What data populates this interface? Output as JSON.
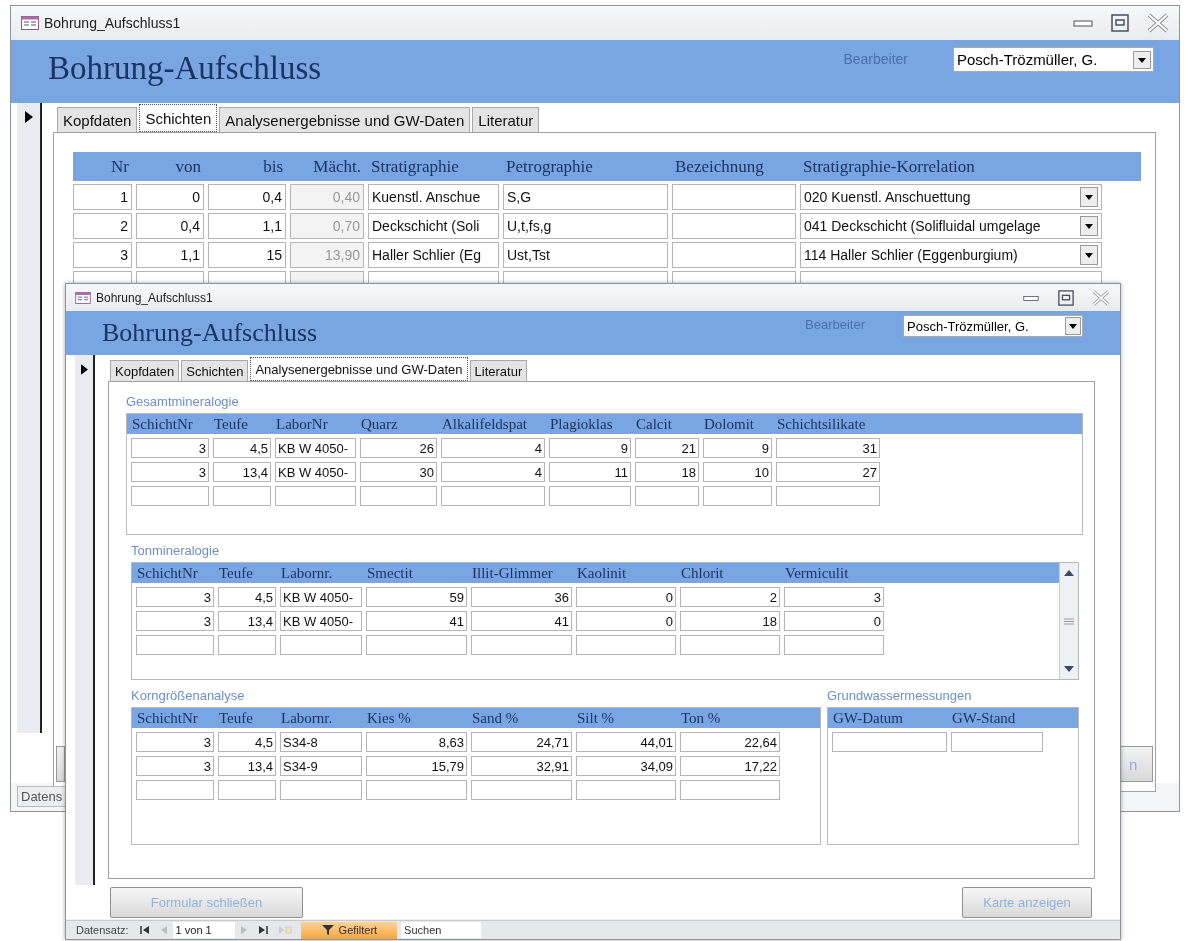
{
  "back_window": {
    "title": "Bohrung_Aufschluss1",
    "heading": "Bohrung-Aufschluss",
    "editor_label": "Bearbeiter",
    "editor": "Posch-Trözmüller, G.",
    "tabs": [
      {
        "label": "Kopfdaten",
        "selected": false
      },
      {
        "label": "Schichten",
        "selected": true
      },
      {
        "label": "Analysenergebnisse und GW-Daten",
        "selected": false
      },
      {
        "label": "Literatur",
        "selected": false
      }
    ],
    "table": {
      "columns": [
        {
          "label": "Nr",
          "kind": "number"
        },
        {
          "label": "von",
          "kind": "number"
        },
        {
          "label": "bis",
          "kind": "number"
        },
        {
          "label": "Mächt.",
          "kind": "computed"
        },
        {
          "label": "Stratigraphie",
          "kind": "text"
        },
        {
          "label": "Petrographie",
          "kind": "text"
        },
        {
          "label": "Bezeichnung",
          "kind": "text"
        },
        {
          "label": "Stratigraphie-Korrelation",
          "kind": "combo"
        }
      ],
      "rows": [
        {
          "nr": "1",
          "von": "0",
          "bis": "0,4",
          "maechtigkeit": "0,40",
          "stratigraphie": "Kuenstl. Anschue",
          "petrographie": "S,G",
          "korrelation": "020 Kuenstl. Anschuettung"
        },
        {
          "nr": "2",
          "von": "0,4",
          "bis": "1,1",
          "maechtigkeit": "0,70",
          "stratigraphie": "Deckschicht (Soli",
          "petrographie": "U,t,fs,g",
          "korrelation": "041 Deckschicht (Solifluidal umgelage"
        },
        {
          "nr": "3",
          "von": "1,1",
          "bis": "15",
          "maechtigkeit": "13,90",
          "stratigraphie": "Haller Schlier (Eg",
          "petrographie": "Ust,Tst",
          "korrelation": "114 Haller Schlier (Eggenburgium)"
        }
      ]
    },
    "button_fragment": "n",
    "status_fragment": "Datens"
  },
  "front_window": {
    "title": "Bohrung_Aufschluss1",
    "heading": "Bohrung-Aufschluss",
    "editor_label": "Bearbeiter",
    "editor": "Posch-Trözmüller, G.",
    "tabs": [
      {
        "label": "Kopfdaten",
        "selected": false
      },
      {
        "label": "Schichten",
        "selected": false
      },
      {
        "label": "Analysenergebnisse und GW-Daten",
        "selected": true
      },
      {
        "label": "Literatur",
        "selected": false
      }
    ],
    "sections": [
      {
        "title": "Gesamtmineralogie",
        "columns": [
          {
            "label": "SchichtNr",
            "kind": "number"
          },
          {
            "label": "Teufe",
            "kind": "number"
          },
          {
            "label": "LaborNr",
            "kind": "text"
          },
          {
            "label": "Quarz",
            "kind": "number"
          },
          {
            "label": "Alkalifeldspat",
            "kind": "number"
          },
          {
            "label": "Plagioklas",
            "kind": "number"
          },
          {
            "label": "Calcit",
            "kind": "number"
          },
          {
            "label": "Dolomit",
            "kind": "number"
          },
          {
            "label": "Schichtsilikate",
            "kind": "number"
          }
        ],
        "rows": [
          [
            "3",
            "4,5",
            "KB W 4050-",
            "26",
            "4",
            "9",
            "21",
            "9",
            "31"
          ],
          [
            "3",
            "13,4",
            "KB W 4050-",
            "30",
            "4",
            "11",
            "18",
            "10",
            "27"
          ]
        ]
      },
      {
        "title": "Tonmineralogie",
        "columns": [
          {
            "label": "SchichtNr",
            "kind": "number"
          },
          {
            "label": "Teufe",
            "kind": "number"
          },
          {
            "label": "Labornr.",
            "kind": "text"
          },
          {
            "label": "Smectit",
            "kind": "number"
          },
          {
            "label": "Illit-Glimmer",
            "kind": "number"
          },
          {
            "label": "Kaolinit",
            "kind": "number"
          },
          {
            "label": "Chlorit",
            "kind": "number"
          },
          {
            "label": "Vermiculit",
            "kind": "number"
          }
        ],
        "rows": [
          [
            "3",
            "4,5",
            "KB W 4050-",
            "59",
            "36",
            "0",
            "2",
            "3"
          ],
          [
            "3",
            "13,4",
            "KB W 4050-",
            "41",
            "41",
            "0",
            "18",
            "0"
          ]
        ]
      },
      {
        "title": "Korngrößenanalyse",
        "columns": [
          {
            "label": "SchichtNr",
            "kind": "number"
          },
          {
            "label": "Teufe",
            "kind": "number"
          },
          {
            "label": "Labornr.",
            "kind": "text"
          },
          {
            "label": "Kies %",
            "kind": "number"
          },
          {
            "label": "Sand %",
            "kind": "number"
          },
          {
            "label": "Silt %",
            "kind": "number"
          },
          {
            "label": "Ton %",
            "kind": "number"
          }
        ],
        "rows": [
          [
            "3",
            "4,5",
            "S34-8",
            "8,63",
            "24,71",
            "44,01",
            "22,64"
          ],
          [
            "3",
            "13,4",
            "S34-9",
            "15,79",
            "32,91",
            "34,09",
            "17,22"
          ]
        ]
      },
      {
        "title": "Grundwassermessungen",
        "columns": [
          {
            "label": "GW-Datum",
            "kind": "text"
          },
          {
            "label": "GW-Stand",
            "kind": "number"
          }
        ]
      }
    ],
    "buttons": [
      {
        "label": "Formular schließen"
      },
      {
        "label": "Karte anzeigen"
      }
    ],
    "status_bar": {
      "label": "Datensatz:",
      "position": "1 von 1",
      "filter": "Gefiltert",
      "filter_active": true,
      "search_placeholder": "Suchen"
    }
  }
}
